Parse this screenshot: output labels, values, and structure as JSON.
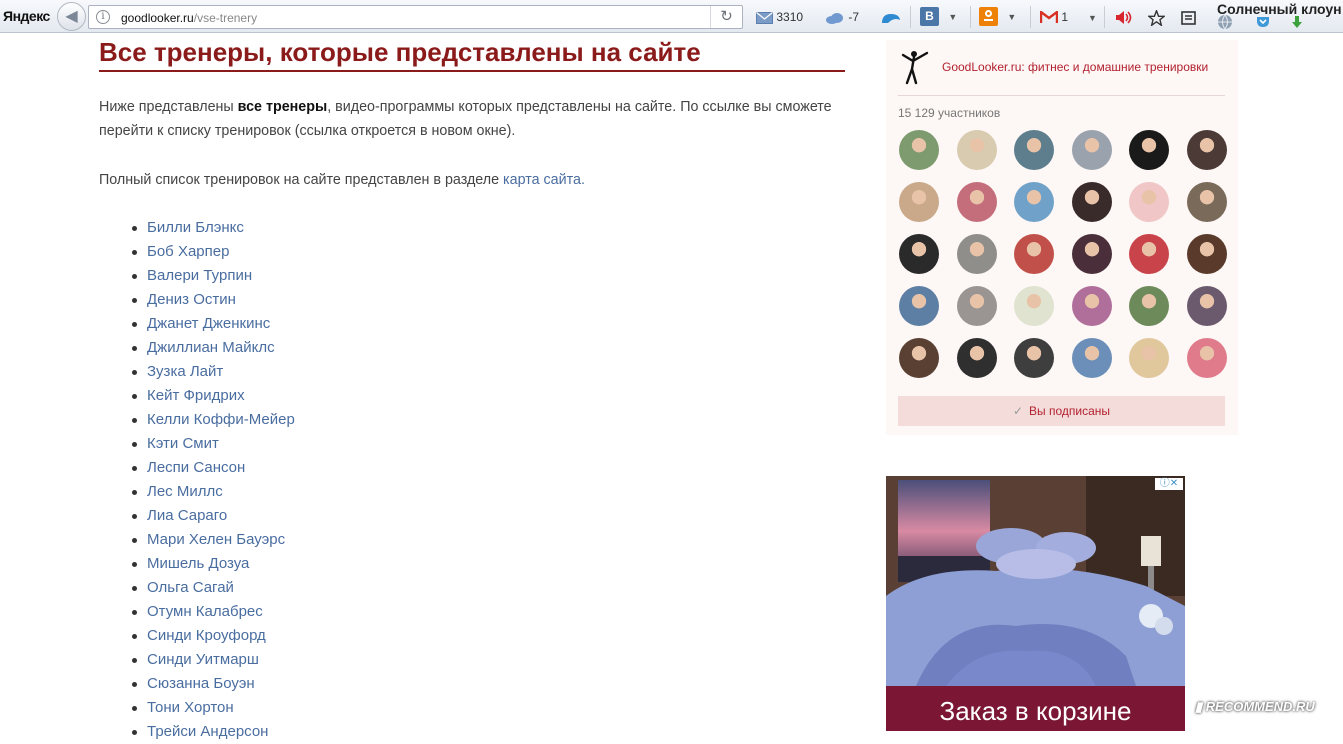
{
  "browser": {
    "brand": "Яндекс",
    "url_domain": "goodlooker.ru",
    "url_path": "/vse-trenery",
    "mail_count": "3310",
    "weather": "-7",
    "vk_label": "В",
    "mail2_count": "1",
    "user_name": "Солнечный клоун",
    "colors": {
      "vk": "#4a76a8",
      "ok": "#ee8208",
      "gmail": "#d93025"
    }
  },
  "page": {
    "title": "Все тренеры, которые представлены на сайте",
    "intro_before": "Ниже представлены ",
    "intro_bold": "все тренеры",
    "intro_after": ", видео-программы которых представлены на сайте. По ссылке вы сможете перейти к списку тренировок (ссылка откроется в новом окне).",
    "fulllist_before": "Полный список тренировок на сайте представлен в разделе ",
    "fulllist_link": "карта сайта",
    "fulllist_after": ".",
    "trainers": [
      "Билли Блэнкс",
      "Боб Харпер",
      "Валери Турпин",
      "Дениз Остин",
      "Джанет Дженкинс",
      "Джиллиан Майклс",
      "Зузка Лайт",
      "Кейт Фридрих",
      "Келли Коффи-Мейер",
      "Кэти Смит",
      "Леспи Сансон",
      "Лес Миллс",
      "Лиа Сараго",
      "Мари Хелен Бауэрс",
      "Мишель Дозуа",
      "Ольга Сагай",
      "Отумн Калабрес",
      "Синди Кроуфорд",
      "Синди Уитмарш",
      "Сюзанна Боуэн",
      "Тони Хортон",
      "Трейси Андерсон"
    ]
  },
  "widget": {
    "title": "GoodLooker.ru: фитнес и домашние тренировки",
    "members": "15 129 участников",
    "subscribed": "Вы подписаны",
    "avatar_colors": [
      "#7d9b6e",
      "#d8cbb0",
      "#5e7d8d",
      "#9aa3ad",
      "#1a1a1a",
      "#4b3a36",
      "#c9a98a",
      "#c46e7c",
      "#6fa1c9",
      "#3a2b2b",
      "#f0c6c6",
      "#7a6a5a",
      "#2a2a2a",
      "#8f8e8a",
      "#c2504a",
      "#4a2f3a",
      "#c9434a",
      "#5a3a2a",
      "#5d7fa3",
      "#9a9593",
      "#dfe3cf",
      "#b06f9a",
      "#6d8a5a",
      "#6b5a6e",
      "#5a4032",
      "#2f2f2f",
      "#3e3e3e",
      "#6b8fb8",
      "#e0c79c",
      "#e07b8c"
    ]
  },
  "ad": {
    "text": "Заказ в корзине"
  },
  "watermark": "RECOMMEND.RU"
}
